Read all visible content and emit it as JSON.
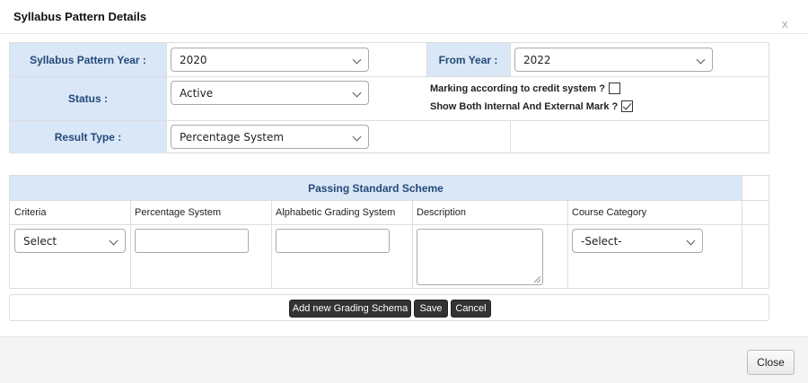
{
  "dialog": {
    "title": "Syllabus Pattern Details",
    "close_x": "x",
    "close_button": "Close"
  },
  "form": {
    "syllabus_year_label": "Syllabus Pattern Year :",
    "syllabus_year_value": "2020",
    "from_year_label": "From Year :",
    "from_year_value": "2022",
    "status_label": "Status :",
    "status_value": "Active",
    "credit_label": "Marking according to credit system ?",
    "credit_checked": false,
    "both_marks_label": "Show Both Internal And External Mark ?",
    "both_marks_checked": true,
    "result_type_label": "Result Type :",
    "result_type_value": "Percentage System"
  },
  "scheme": {
    "title": "Passing Standard Scheme",
    "columns": [
      "Criteria",
      "Percentage System",
      "Alphabetic Grading System",
      "Description",
      "Course Category"
    ],
    "criteria_value": "Select",
    "percentage_value": "",
    "alphabetic_value": "",
    "description_value": "",
    "course_category_value": "-Select-"
  },
  "actions": {
    "add_label": "Add new Grading Schema",
    "save_label": "Save",
    "cancel_label": "Cancel"
  },
  "colors": {
    "label_bg": "#d9e7f7",
    "label_text": "#244a78",
    "dark_button": "#333333"
  }
}
